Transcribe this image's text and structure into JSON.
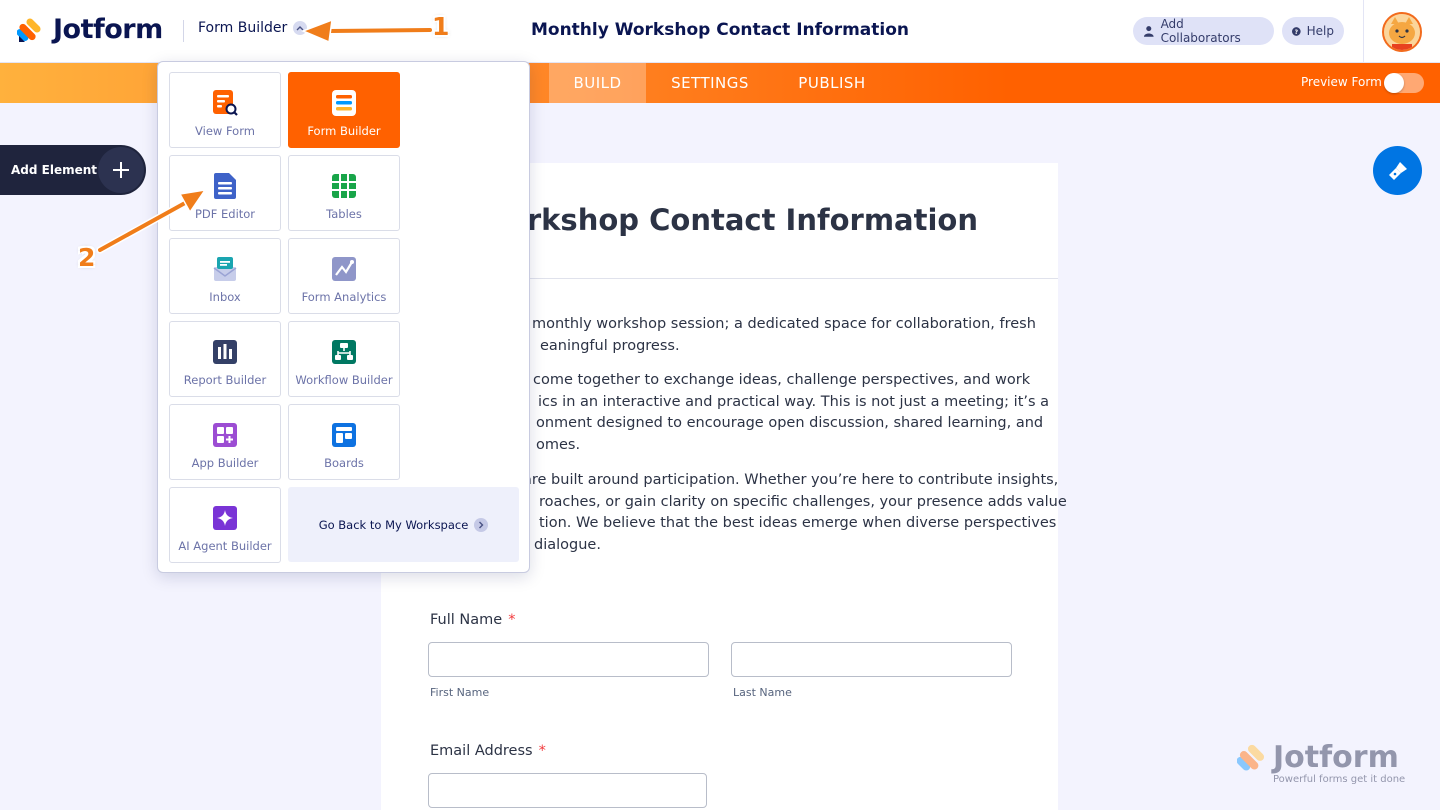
{
  "header": {
    "logo_text": "Jotform",
    "builder_dropdown_label": "Form Builder",
    "form_title": "Monthly Workshop Contact Information",
    "add_collaborators_label": "Add Collaborators",
    "help_label": "Help"
  },
  "nav": {
    "tabs": [
      {
        "label": "BUILD",
        "active": true
      },
      {
        "label": "SETTINGS",
        "active": false
      },
      {
        "label": "PUBLISH",
        "active": false
      }
    ],
    "preview_label": "Preview Form",
    "preview_on": false
  },
  "add_element": {
    "label": "Add Element"
  },
  "menu": {
    "items": [
      {
        "label": "View Form",
        "icon": "view-form-icon"
      },
      {
        "label": "Form Builder",
        "icon": "form-builder-icon",
        "active": true
      },
      {
        "label": "PDF Editor",
        "icon": "pdf-editor-icon"
      },
      {
        "label": "Tables",
        "icon": "tables-icon"
      },
      {
        "label": "Inbox",
        "icon": "inbox-icon"
      },
      {
        "label": "Form Analytics",
        "icon": "form-analytics-icon"
      },
      {
        "label": "Report Builder",
        "icon": "report-builder-icon"
      },
      {
        "label": "Workflow Builder",
        "icon": "workflow-builder-icon"
      },
      {
        "label": "App Builder",
        "icon": "app-builder-icon"
      },
      {
        "label": "Boards",
        "icon": "boards-icon"
      },
      {
        "label": "AI Agent Builder",
        "icon": "ai-agent-builder-icon"
      }
    ],
    "workspace_label": "Go Back to My Workspace"
  },
  "form": {
    "title_visible": "y Workshop Contact Information",
    "paragraphs": [
      [
        "monthly workshop session; a dedicated space for collaboration, fresh",
        "eaningful progress."
      ],
      [
        "come together to exchange ideas, challenge perspectives, and work",
        "ics in an interactive and practical way. This is not just a meeting; it’s a",
        "onment designed to encourage open discussion, shared learning, and",
        "omes."
      ],
      [
        "are built around participation. Whether you’re here to contribute insights,",
        "roaches, or gain clarity on specific challenges, your presence adds value",
        "tion. We believe that the best ideas emerge when diverse perspectives",
        "dialogue."
      ]
    ],
    "full_name_label": "Full Name",
    "first_name_sublabel": "First Name",
    "last_name_sublabel": "Last Name",
    "email_label": "Email Address",
    "required_mark": "*"
  },
  "annotations": {
    "step1": "1",
    "step2": "2"
  },
  "watermark": {
    "word": "Jotform",
    "tagline": "Powerful forms get it done"
  },
  "colors": {
    "accent": "#ff6100",
    "navy": "#0a1551",
    "blue": "#0075e3"
  }
}
